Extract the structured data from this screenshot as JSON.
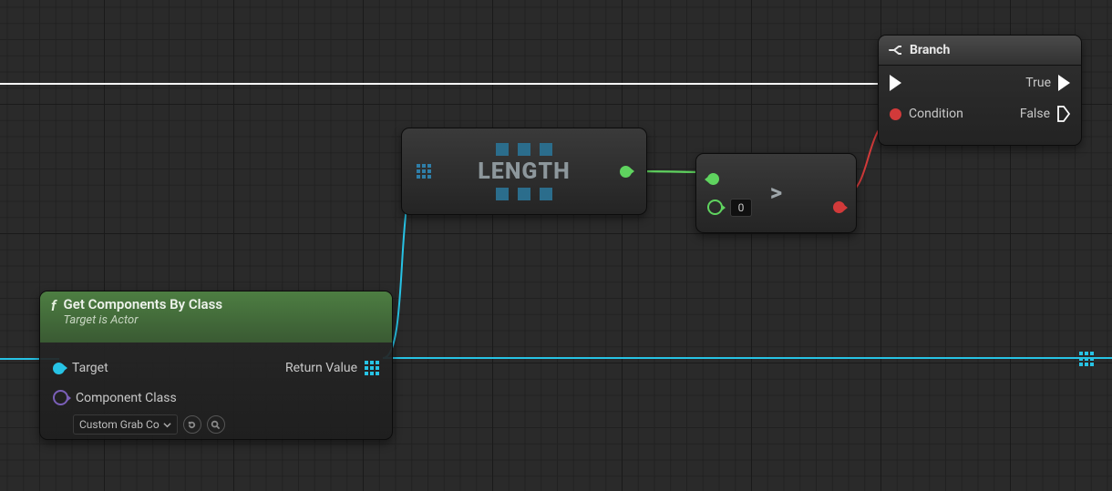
{
  "nodes": {
    "func": {
      "title": "Get Components By Class",
      "subtitle": "Target is Actor",
      "target_label": "Target",
      "return_label": "Return Value",
      "component_class_label": "Component Class",
      "component_class_value": "Custom Grab Co"
    },
    "length": {
      "label": "LENGTH"
    },
    "compare": {
      "operator": ">",
      "b_default": "0"
    },
    "branch": {
      "title": "Branch",
      "condition_label": "Condition",
      "true_label": "True",
      "false_label": "False"
    }
  },
  "colors": {
    "exec": "#ffffff",
    "object": "#27c3e5",
    "int": "#5fd35f",
    "bool": "#d23a3a",
    "class": "#7a5fb8",
    "array": "#2f7ea8"
  }
}
